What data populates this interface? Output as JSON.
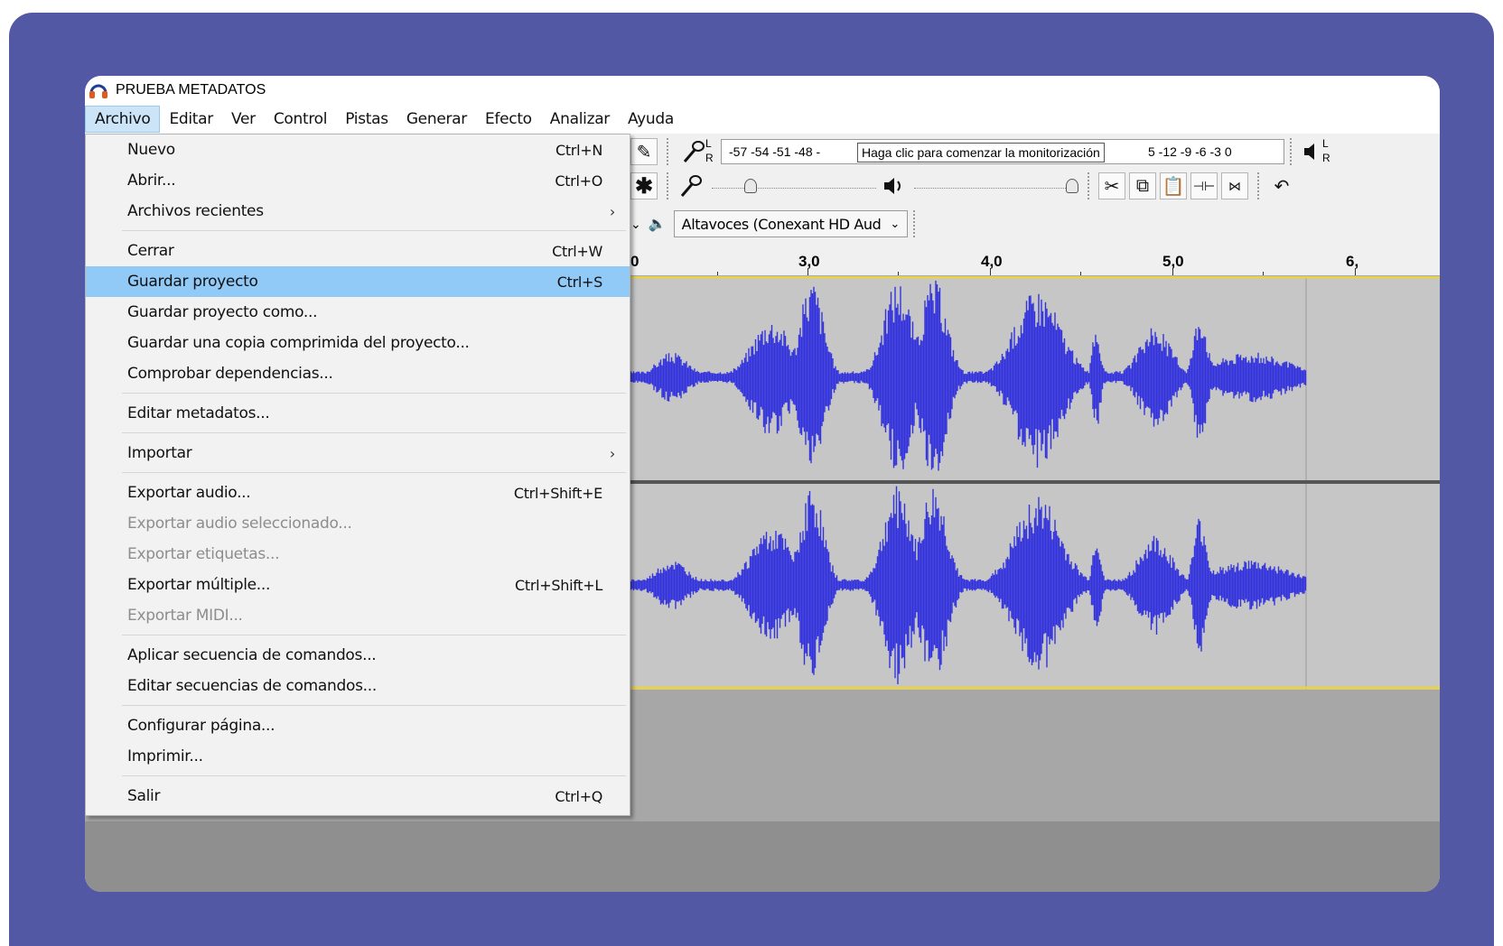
{
  "window": {
    "title": "PRUEBA METADATOS"
  },
  "menubar": [
    "Archivo",
    "Editar",
    "Ver",
    "Control",
    "Pistas",
    "Generar",
    "Efecto",
    "Analizar",
    "Ayuda"
  ],
  "file_menu": {
    "items": [
      {
        "label": "Nuevo",
        "shortcut": "Ctrl+N"
      },
      {
        "label": "Abrir...",
        "shortcut": "Ctrl+O"
      },
      {
        "label": "Archivos recientes",
        "shortcut": ""
      },
      {
        "label": "Cerrar",
        "shortcut": "Ctrl+W"
      },
      {
        "label": "Guardar proyecto",
        "shortcut": "Ctrl+S"
      },
      {
        "label": "Guardar proyecto como...",
        "shortcut": ""
      },
      {
        "label": "Guardar una copia comprimida del proyecto...",
        "shortcut": ""
      },
      {
        "label": "Comprobar dependencias...",
        "shortcut": ""
      },
      {
        "label": "Editar metadatos...",
        "shortcut": ""
      },
      {
        "label": "Importar",
        "shortcut": ""
      },
      {
        "label": "Exportar audio...",
        "shortcut": "Ctrl+Shift+E"
      },
      {
        "label": "Exportar audio seleccionado...",
        "shortcut": ""
      },
      {
        "label": "Exportar etiquetas...",
        "shortcut": ""
      },
      {
        "label": "Exportar múltiple...",
        "shortcut": "Ctrl+Shift+L"
      },
      {
        "label": "Exportar MIDI...",
        "shortcut": ""
      },
      {
        "label": "Aplicar secuencia de comandos...",
        "shortcut": ""
      },
      {
        "label": "Editar secuencias de comandos...",
        "shortcut": ""
      },
      {
        "label": "Configurar página...",
        "shortcut": ""
      },
      {
        "label": "Imprimir...",
        "shortcut": ""
      },
      {
        "label": "Salir",
        "shortcut": "Ctrl+Q"
      }
    ],
    "highlighted": "Guardar proyecto",
    "disabled": [
      "Exportar audio seleccionado...",
      "Exportar etiquetas...",
      "Exportar MIDI..."
    ],
    "submenus": [
      "Archivos recientes",
      "Importar"
    ]
  },
  "meter": {
    "ticks_left": "-57 -54 -51 -48 -",
    "tooltip": "Haga clic para comenzar la monitorización",
    "ticks_right": "5 -12 -9 -6 -3 0"
  },
  "meter_lr": {
    "l": "L",
    "r": "R"
  },
  "output_device": "Altavoces (Conexant HD Aud",
  "ruler": {
    "labels": [
      "0",
      "3,0",
      "4,0",
      "5,0",
      "6,"
    ]
  },
  "colors": {
    "frame": "#5358a4",
    "waveform": "#3333dd",
    "menu_highlight": "#91c9f7",
    "track_bg": "#c6c6c6"
  },
  "icons": [
    "headphones-icon",
    "pencil-icon",
    "multi-tool-icon",
    "mic-icon",
    "speaker-icon",
    "cut-icon",
    "copy-icon",
    "paste-icon",
    "trim-icon",
    "silence-icon",
    "undo-icon"
  ]
}
